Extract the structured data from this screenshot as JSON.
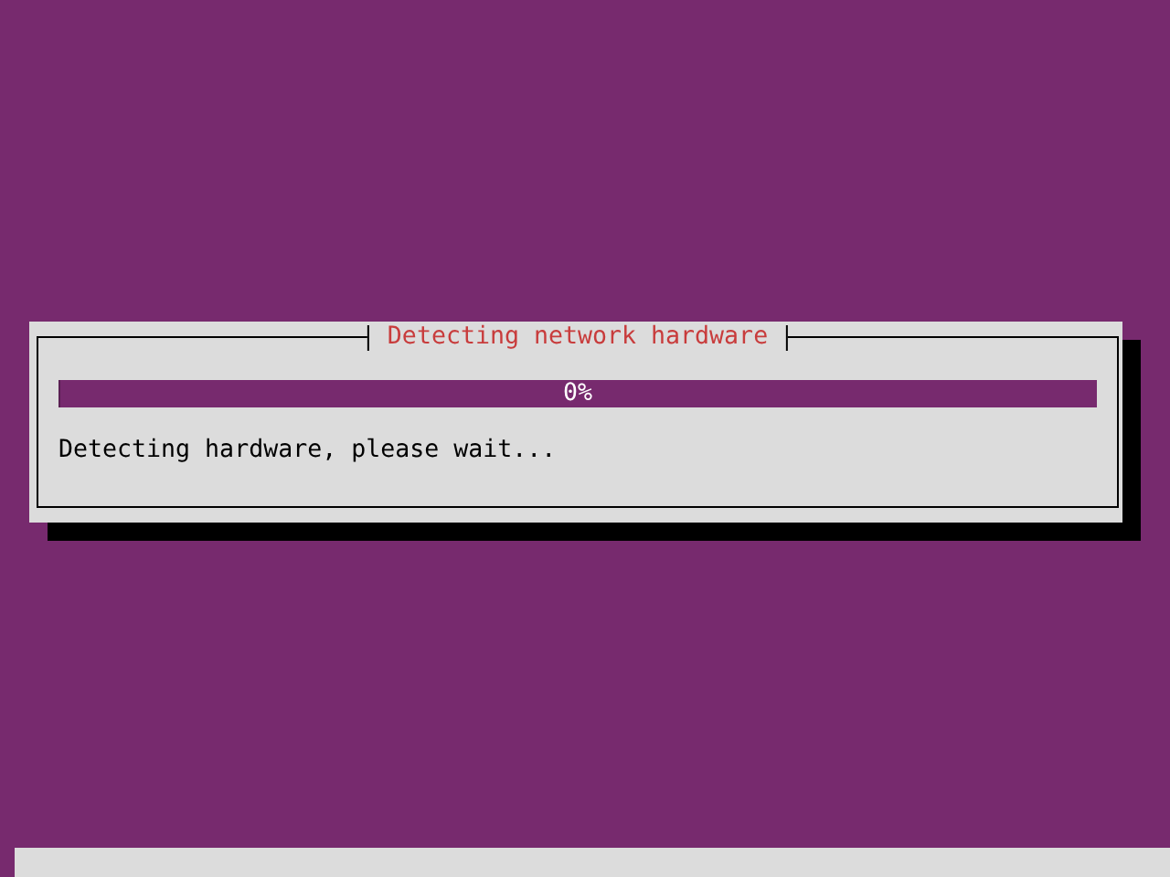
{
  "dialog": {
    "title": "Detecting network hardware",
    "progress": {
      "level": 0,
      "reading": "0%"
    },
    "message": "Detecting hardware, please wait..."
  }
}
